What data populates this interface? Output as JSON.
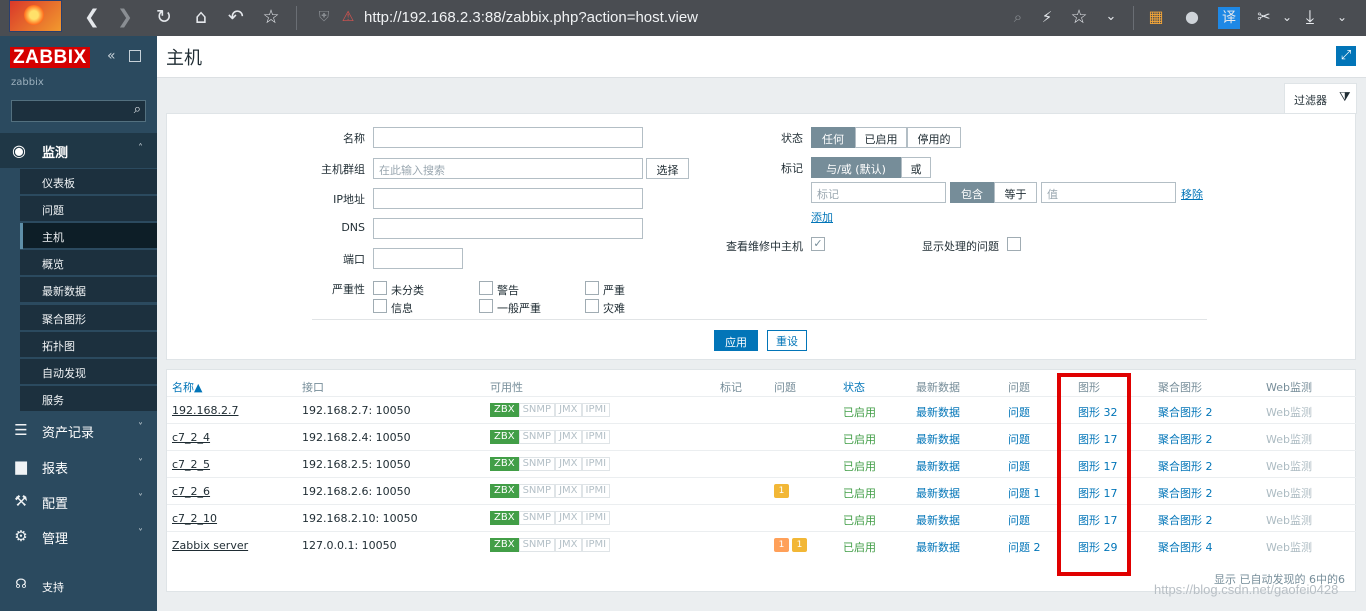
{
  "browser": {
    "url": "http://192.168.2.3:88/zabbix.php?action=host.view",
    "translate_label": "译"
  },
  "sidebar": {
    "brand": "ZABBIX",
    "server_name": "zabbix",
    "monitoring": {
      "label": "监测",
      "items": [
        "仪表板",
        "问题",
        "主机",
        "概览",
        "最新数据",
        "聚合图形",
        "拓扑图",
        "自动发现",
        "服务"
      ],
      "active_index": 2
    },
    "menus": [
      {
        "label": "资产记录",
        "icon": "list-icon"
      },
      {
        "label": "报表",
        "icon": "chart-icon"
      },
      {
        "label": "配置",
        "icon": "wrench-icon"
      },
      {
        "label": "管理",
        "icon": "gear-icon"
      }
    ],
    "support": "支持"
  },
  "page": {
    "title": "主机"
  },
  "filter": {
    "tab_label": "过滤器",
    "name_label": "名称",
    "name_value": "",
    "hostgroup_label": "主机群组",
    "hostgroup_placeholder": "在此输入搜索",
    "select_button": "选择",
    "ip_label": "IP地址",
    "dns_label": "DNS",
    "port_label": "端口",
    "severity_label": "严重性",
    "severities": [
      "未分类",
      "警告",
      "严重",
      "信息",
      "一般严重",
      "灾难"
    ],
    "status_label": "状态",
    "status_options": [
      "任何",
      "已启用",
      "停用的"
    ],
    "tags_label": "标记",
    "tag_logic_options": [
      "与/或 (默认)",
      "或"
    ],
    "tag_placeholder": "标记",
    "tag_operators": [
      "包含",
      "等于"
    ],
    "value_placeholder": "值",
    "remove_link": "移除",
    "add_link": "添加",
    "show_maintenance_label": "查看维修中主机",
    "show_maintenance_checked": true,
    "show_suppressed_label": "显示处理的问题",
    "show_suppressed_checked": false,
    "apply_button": "应用",
    "reset_button": "重设"
  },
  "table": {
    "headers": [
      "名称▲",
      "接口",
      "可用性",
      "标记",
      "问题",
      "状态",
      "最新数据",
      "问题",
      "图形",
      "聚合图形",
      "Web监测"
    ],
    "availability_labels": [
      "ZBX",
      "SNMP",
      "JMX",
      "IPMI"
    ],
    "rows": [
      {
        "name": "192.168.2.7",
        "interface": "192.168.2.7: 10050",
        "problems": [],
        "status": "已启用",
        "latest": "最新数据",
        "problems_link": "问题",
        "graphs": "图形 32",
        "screens": "聚合图形 2",
        "web": "Web监测"
      },
      {
        "name": "c7_2_4",
        "interface": "192.168.2.4: 10050",
        "problems": [],
        "status": "已启用",
        "latest": "最新数据",
        "problems_link": "问题",
        "graphs": "图形 17",
        "screens": "聚合图形 2",
        "web": "Web监测"
      },
      {
        "name": "c7_2_5",
        "interface": "192.168.2.5: 10050",
        "problems": [],
        "status": "已启用",
        "latest": "最新数据",
        "problems_link": "问题",
        "graphs": "图形 17",
        "screens": "聚合图形 2",
        "web": "Web监测"
      },
      {
        "name": "c7_2_6",
        "interface": "192.168.2.6: 10050",
        "problems": [
          {
            "count": "1",
            "color": "#f2b736"
          }
        ],
        "status": "已启用",
        "latest": "最新数据",
        "problems_link": "问题 1",
        "graphs": "图形 17",
        "screens": "聚合图形 2",
        "web": "Web监测"
      },
      {
        "name": "c7_2_10",
        "interface": "192.168.2.10: 10050",
        "problems": [],
        "status": "已启用",
        "latest": "最新数据",
        "problems_link": "问题",
        "graphs": "图形 17",
        "screens": "聚合图形 2",
        "web": "Web监测"
      },
      {
        "name": "Zabbix server",
        "interface": "127.0.0.1: 10050",
        "problems": [
          {
            "count": "1",
            "color": "#ffa059"
          },
          {
            "count": "1",
            "color": "#f2b736"
          }
        ],
        "status": "已启用",
        "latest": "最新数据",
        "problems_link": "问题 2",
        "graphs": "图形 29",
        "screens": "聚合图形 4",
        "web": "Web监测"
      }
    ],
    "footer": "显示 已自动发现的 6中的6"
  },
  "watermark": "https://blog.csdn.net/gaofei0428",
  "colors": {
    "brand_red": "#d40000",
    "link_blue": "#0275b8",
    "enabled_green": "#429e47",
    "highlight_red": "#e00000"
  }
}
